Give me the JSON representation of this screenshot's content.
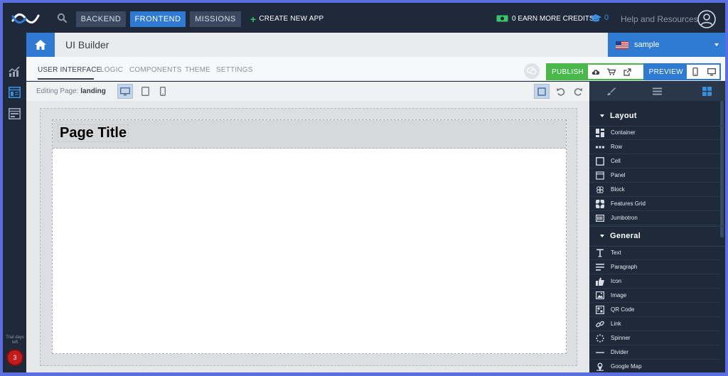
{
  "topbar": {
    "nav": [
      {
        "label": "BACKEND",
        "active": false
      },
      {
        "label": "FRONTEND",
        "active": true
      },
      {
        "label": "MISSIONS",
        "active": false
      }
    ],
    "create_new_app": "CREATE NEW APP",
    "credits": "0 EARN MORE CREDITS",
    "cap_count": "0",
    "help": "Help and Resources"
  },
  "title_bar": {
    "title": "UI Builder",
    "environment": "sample"
  },
  "tabs": [
    {
      "label": "USER INTERFACE",
      "active": true
    },
    {
      "label": "LOGIC",
      "active": false
    },
    {
      "label": "COMPONENTS",
      "active": false
    },
    {
      "label": "THEME",
      "active": false
    },
    {
      "label": "SETTINGS",
      "active": false
    }
  ],
  "actions": {
    "publish": "PUBLISH",
    "preview": "PREVIEW"
  },
  "editor": {
    "editing_label": "Editing Page:",
    "page_name": "landing"
  },
  "canvas": {
    "page_title": "Page Title"
  },
  "left_bar": {
    "trial_text": "Trial days left",
    "trial_days": "3"
  },
  "palette": {
    "sections": [
      {
        "title": "Layout",
        "items": [
          {
            "label": "Container",
            "icon": "container-icon"
          },
          {
            "label": "Row",
            "icon": "row-icon"
          },
          {
            "label": "Cell",
            "icon": "cell-icon"
          },
          {
            "label": "Panel",
            "icon": "panel-icon"
          },
          {
            "label": "Block",
            "icon": "block-icon"
          },
          {
            "label": "Features Grid",
            "icon": "features-grid-icon"
          },
          {
            "label": "Jumbotron",
            "icon": "jumbotron-icon"
          }
        ]
      },
      {
        "title": "General",
        "items": [
          {
            "label": "Text",
            "icon": "text-icon"
          },
          {
            "label": "Paragraph",
            "icon": "paragraph-icon"
          },
          {
            "label": "Icon",
            "icon": "thumbs-up-icon"
          },
          {
            "label": "Image",
            "icon": "image-icon"
          },
          {
            "label": "QR Code",
            "icon": "qr-code-icon"
          },
          {
            "label": "Link",
            "icon": "link-icon"
          },
          {
            "label": "Spinner",
            "icon": "spinner-icon"
          },
          {
            "label": "Divider",
            "icon": "divider-icon"
          },
          {
            "label": "Google Map",
            "icon": "map-icon"
          }
        ]
      }
    ]
  },
  "colors": {
    "primary": "#2f7bd4",
    "success": "#48b84a",
    "dark_bg": "#1e2a3a",
    "badge": "#c41a1a"
  }
}
